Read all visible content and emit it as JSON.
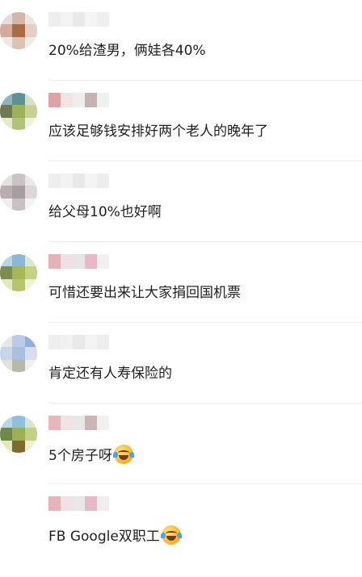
{
  "comments": [
    {
      "text": "20%给渣男，俩娃各40%",
      "avatar_colors": [
        "#e6dcdc",
        "#d4b7a8",
        "#ece6e0",
        "#d7a99a",
        "#a86b45",
        "#e3cfc6",
        "#eee8e4",
        "#dcc3b6",
        "#f2ece8"
      ],
      "name_colors": [
        "#eeeeee",
        "#f3f3f3",
        "#e9e9e9",
        "#f5f5f5",
        "#efefef"
      ]
    },
    {
      "text": "应该足够钱安排好两个老人的晚年了",
      "avatar_colors": [
        "#8fb3b8",
        "#5f8f98",
        "#d8e0c8",
        "#6f7a50",
        "#9fb05a",
        "#c9cf96",
        "#e7eac6",
        "#b3c27a",
        "#f0f1dc"
      ],
      "name_colors": [
        "#dba5a5",
        "#f3e3e3",
        "#eeeeee",
        "#c6b2b0",
        "#f0f0f0"
      ]
    },
    {
      "text": "给父母10%也好啊",
      "avatar_colors": [
        "#e4e1e1",
        "#c9c3c5",
        "#ebe8e8",
        "#b9adb0",
        "#a79ea2",
        "#ddd7d8",
        "#efedee",
        "#c8c1c3",
        "#f4f2f2"
      ],
      "name_colors": [
        "#eeeeee",
        "#f2f2f2",
        "#e8e8e8",
        "#f4f4f4",
        "#ededed"
      ]
    },
    {
      "text": "可惜还要出来让大家捐回国机票",
      "avatar_colors": [
        "#b8d4e6",
        "#8fb6d6",
        "#dce9d2",
        "#7e8c50",
        "#a7b657",
        "#c7d083",
        "#e4e9bc",
        "#b8c46e",
        "#f0f2d8"
      ],
      "name_colors": [
        "#e3b3b8",
        "#f1e0e3",
        "#e6e6e6",
        "#e8b7c8",
        "#f0f0f0"
      ]
    },
    {
      "text": "肯定还有人寿保险的",
      "avatar_colors": [
        "#e6e6e6",
        "#b9cbe6",
        "#8fb1e0",
        "#c8d4e8",
        "#a9bfe2",
        "#d6deec",
        "#e2e2d8",
        "#b8b8a8",
        "#f0f0ec"
      ],
      "name_colors": [
        "#eeeeee",
        "#f1f1f1",
        "#e9e9e9",
        "#f3f3f3",
        "#ededed"
      ]
    },
    {
      "text": "5个房子呀",
      "avatar_colors": [
        "#b8d8e8",
        "#8fc1dd",
        "#d9e6cf",
        "#6e8a45",
        "#9bb055",
        "#c5cf86",
        "#e6e9bc",
        "#7d6a30",
        "#eef0d4"
      ],
      "name_colors": [
        "#e6b8bb",
        "#f1e2e3",
        "#e8e8e8",
        "#cbb6b4",
        "#f0f0f0"
      ],
      "emoji": "grin-tears-icon"
    },
    {
      "text": "FB Google双职工",
      "avatar_colors": [
        "#ffffff",
        "#ffffff",
        "#ffffff",
        "#ffffff",
        "#ffffff",
        "#ffffff",
        "#ffffff",
        "#ffffff",
        "#ffffff"
      ],
      "name_colors": [
        "#e4b4b8",
        "#f1e1e3",
        "#e8e8e8",
        "#e7b9c7",
        "#eeeeee"
      ],
      "emoji": "grin-tears-icon"
    }
  ]
}
